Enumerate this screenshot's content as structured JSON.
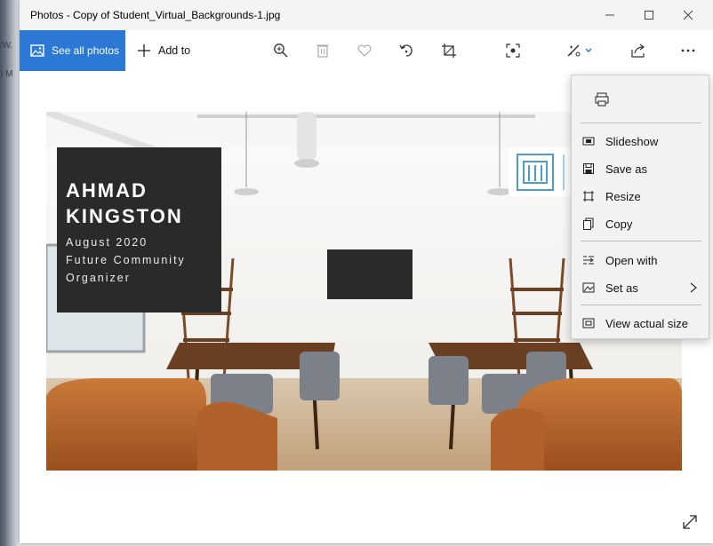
{
  "window": {
    "title": "Photos - Copy of Student_Virtual_Backgrounds-1.jpg",
    "controls": [
      "minimize-icon",
      "maximize-icon",
      "close-icon"
    ]
  },
  "background_fragments": {
    "left_top": "/W.",
    "left_mid": ") M"
  },
  "toolbar": {
    "see_all_photos": "See all photos",
    "add_to": "Add to",
    "tools": [
      "zoom-in-icon",
      "delete-icon",
      "favorite-heart-icon",
      "rotate-icon",
      "crop-icon",
      "enhance-icon",
      "edit-create-icon",
      "share-icon",
      "more-options-icon"
    ]
  },
  "photo": {
    "name_line1": "AHMAD",
    "name_line2": "KINGSTON",
    "subtitle_line1": "August 2020",
    "subtitle_line2": "Future Community",
    "subtitle_line3": "Organizer"
  },
  "more_menu": {
    "print_icon": "print-icon",
    "items": [
      {
        "label": "Slideshow",
        "icon": "slideshow-icon"
      },
      {
        "label": "Save as",
        "icon": "save-icon"
      },
      {
        "label": "Resize",
        "icon": "resize-icon"
      },
      {
        "label": "Copy",
        "icon": "copy-icon"
      },
      {
        "label": "Open with",
        "icon": "open-with-icon"
      },
      {
        "label": "Set as",
        "icon": "set-as-icon"
      },
      {
        "label": "View actual size",
        "icon": "actual-size-icon"
      }
    ]
  },
  "colors": {
    "accent": "#2b78d5",
    "menu_bg": "#f2f2f2",
    "sofa": "#b8642a"
  }
}
